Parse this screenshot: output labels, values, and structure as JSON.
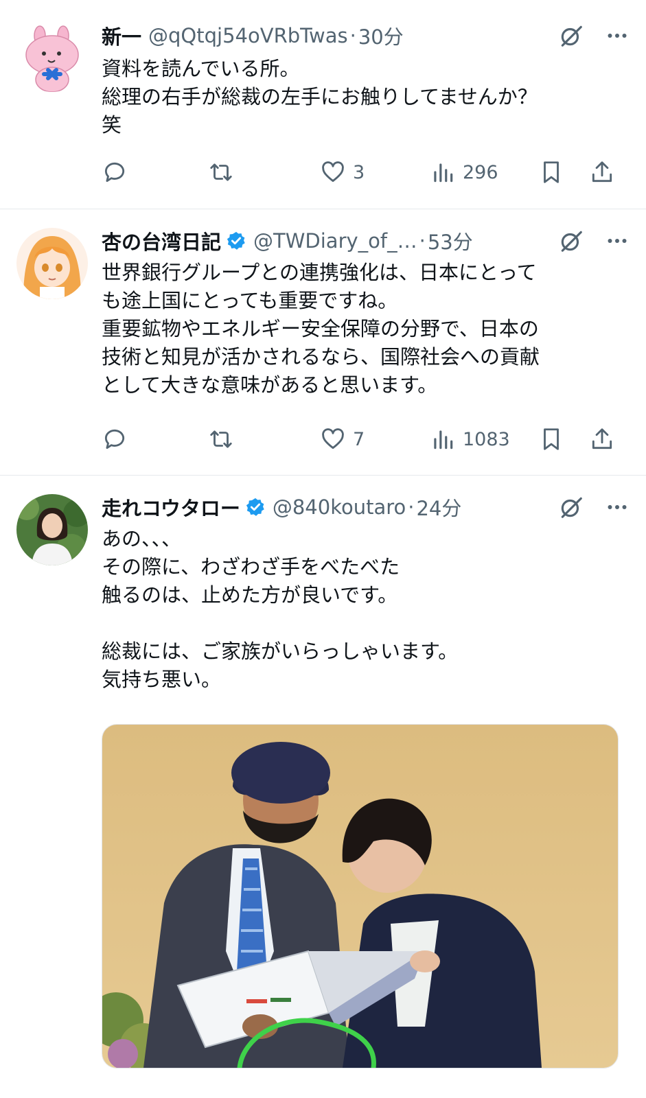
{
  "tweets": [
    {
      "avatar": "pink-rabbit-avatar",
      "name": "新一",
      "verified": false,
      "handle": "@qQtqj54oVRbTwas",
      "dot": "·",
      "time": "30分",
      "text": "資料を読んでいる所。\n総理の右手が総裁の左手にお触りしてませんか？\n笑",
      "reply_count": "",
      "retweet_count": "",
      "like_count": "3",
      "view_count": "296"
    },
    {
      "avatar": "anime-girl-avatar",
      "name": "杏の台湾日記",
      "verified": true,
      "handle": "@TWDiary_of_…",
      "dot": "·",
      "time": "53分",
      "text": "世界銀行グループとの連携強化は、日本にとって\nも途上国にとっても重要ですね。\n重要鉱物やエネルギー安全保障の分野で、日本の\n技術と知見が活かされるなら、国際社会への貢献\nとして大きな意味があると思います。",
      "reply_count": "",
      "retweet_count": "",
      "like_count": "7",
      "view_count": "1083"
    },
    {
      "avatar": "woman-photo-avatar",
      "name": "走れコウタロー",
      "verified": true,
      "handle": "@840koutaro",
      "dot": "·",
      "time": "24分",
      "text": "あの、、、\nその際に、わざわざ手をべたべた\n触るのは、止めた方が良いです。\n\n総裁には、ご家族がいらっしゃいます。\n気持ち悪い。",
      "media": "photo-two-people-reading-document"
    }
  ],
  "colors": {
    "text": "#0f1419",
    "secondary": "#536471",
    "verified": "#1d9bf0",
    "divider": "#e6e9ec"
  },
  "icons": [
    "reply-icon",
    "retweet-icon",
    "like-icon",
    "views-icon",
    "bookmark-icon",
    "share-icon",
    "grok-icon",
    "more-icon",
    "verified-badge-icon"
  ]
}
